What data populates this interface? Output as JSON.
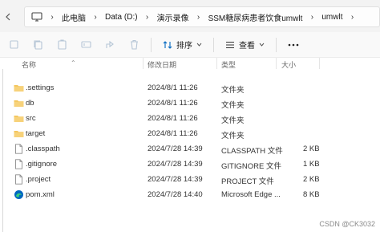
{
  "breadcrumb": [
    "此电脑",
    "Data (D:)",
    "演示录像",
    "SSM糖尿病患者饮食umwlt",
    "umwlt"
  ],
  "toolbar": {
    "sort_label": "排序",
    "view_label": "查看"
  },
  "columns": {
    "name": "名称",
    "modified": "修改日期",
    "type": "类型",
    "size": "大小"
  },
  "files": [
    {
      "name": ".settings",
      "modified": "2024/8/1 11:26",
      "type": "文件夹",
      "size": "",
      "icon": "folder-icon"
    },
    {
      "name": "db",
      "modified": "2024/8/1 11:26",
      "type": "文件夹",
      "size": "",
      "icon": "folder-icon"
    },
    {
      "name": "src",
      "modified": "2024/8/1 11:26",
      "type": "文件夹",
      "size": "",
      "icon": "folder-icon"
    },
    {
      "name": "target",
      "modified": "2024/8/1 11:26",
      "type": "文件夹",
      "size": "",
      "icon": "folder-icon"
    },
    {
      "name": ".classpath",
      "modified": "2024/7/28 14:39",
      "type": "CLASSPATH 文件",
      "size": "2 KB",
      "icon": "file-icon"
    },
    {
      "name": ".gitignore",
      "modified": "2024/7/28 14:39",
      "type": "GITIGNORE 文件",
      "size": "1 KB",
      "icon": "file-icon"
    },
    {
      "name": ".project",
      "modified": "2024/7/28 14:39",
      "type": "PROJECT 文件",
      "size": "2 KB",
      "icon": "file-icon"
    },
    {
      "name": "pom.xml",
      "modified": "2024/7/28 14:40",
      "type": "Microsoft Edge ...",
      "size": "8 KB",
      "icon": "edge-icon"
    }
  ],
  "watermark": "CSDN @CK3032",
  "colors": {
    "folder": "#f4c55b",
    "accent": "#0067c0"
  }
}
